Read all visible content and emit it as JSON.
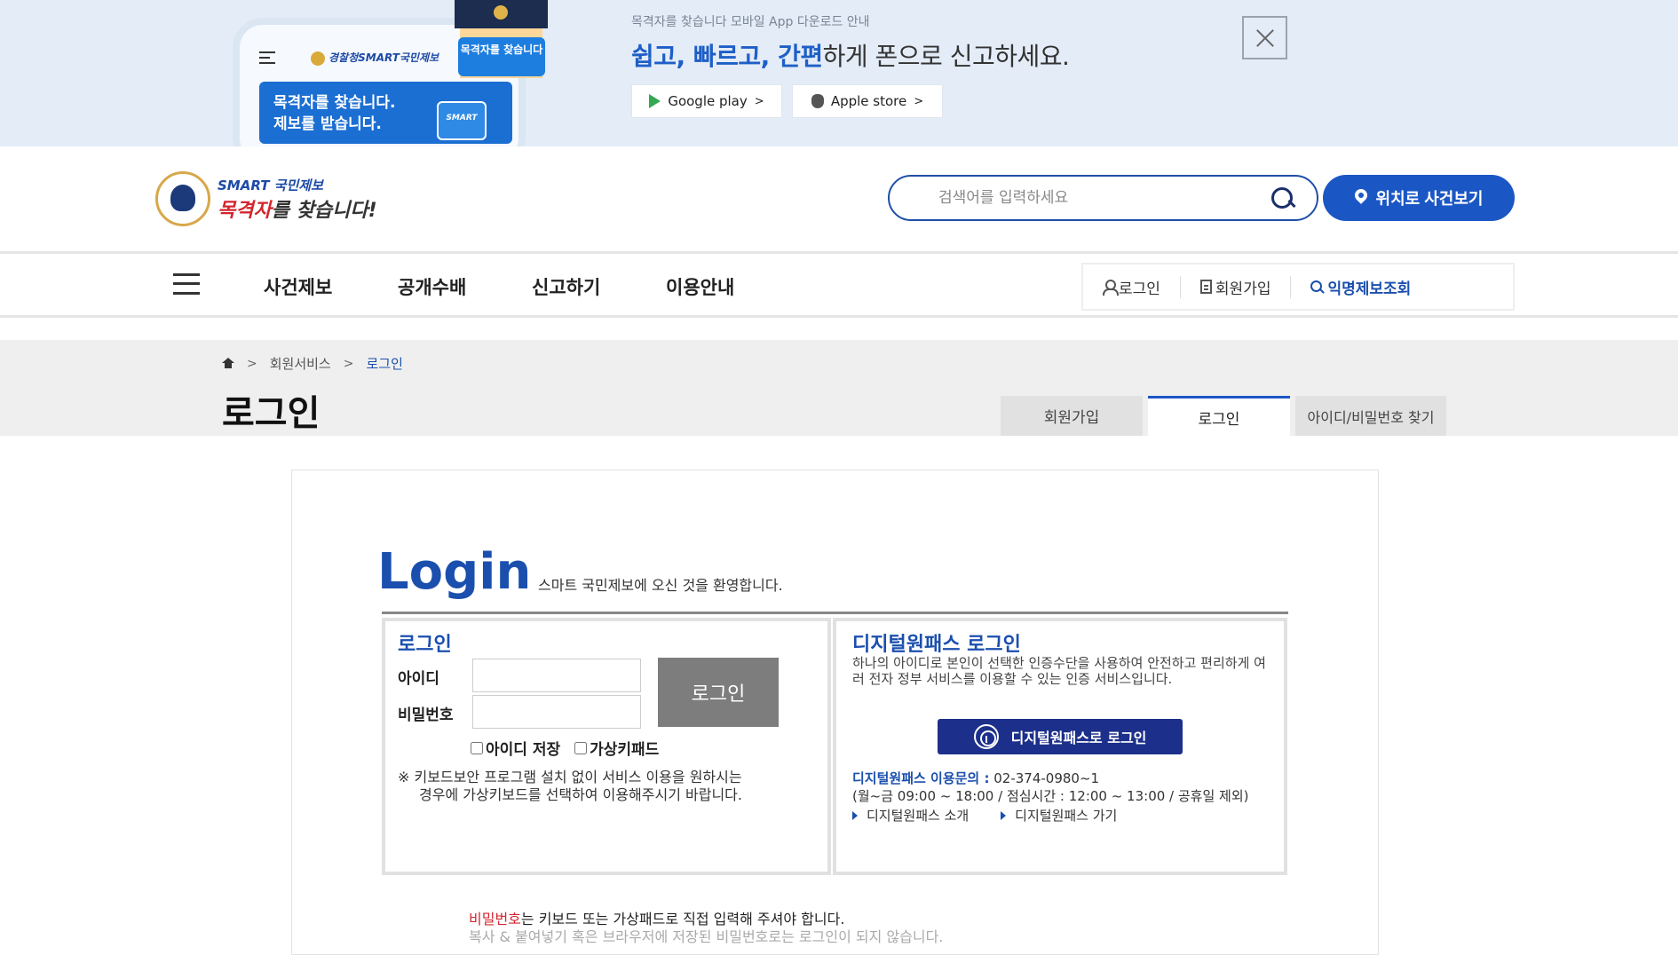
{
  "banner": {
    "subtitle": "목격자를 찾습니다 모바일 App 다운로드 안내",
    "headline_highlight": "쉽고, 빠르고, 간편",
    "headline_rest": "하게 폰으로 신고하세요.",
    "google_label": "Google play",
    "apple_label": "Apple store",
    "chevron": ">",
    "phone_logo": "경찰청SMART국민제보",
    "phone_card_line1": "목격자를 찾습니다.",
    "phone_card_line2": "제보를 받습니다.",
    "phone_mini": "SMART",
    "mascot_sign": "목격자를 찾습니다"
  },
  "header": {
    "logo_top": "SMART 국민제보",
    "logo_bottom_red": "목격자",
    "logo_bottom_rest": "를 찾습니다!",
    "search_placeholder": "검색어를 입력하세요",
    "location_button": "위치로 사건보기"
  },
  "nav": {
    "items": [
      "사건제보",
      "공개수배",
      "신고하기",
      "이용안내"
    ],
    "util": {
      "login": "로그인",
      "signup": "회원가입",
      "anonymous": "익명제보조회"
    }
  },
  "page": {
    "breadcrumb": [
      "회원서비스",
      "로그인"
    ],
    "crumb_sep": ">",
    "title": "로그인",
    "tabs": [
      "회원가입",
      "로그인",
      "아이디/비밀번호 찾기"
    ]
  },
  "login": {
    "heading": "Login",
    "welcome": "스마트 국민제보에 오신 것을 환영합니다.",
    "panel_title": "로그인",
    "id_label": "아이디",
    "pw_label": "비밀번호",
    "button": "로그인",
    "save_id": "아이디 저장",
    "virtual_keypad": "가상키패드",
    "note_line1": "※ 키보드보안 프로그램 설치 없이 서비스 이용을 원하시는",
    "note_line2": "경우에 가상키보드를 선택하여 이용해주시기 바랍니다."
  },
  "digital_onepass": {
    "title": "디지털원패스 로그인",
    "description": "하나의 아이디로 본인이 선택한 인증수단을 사용하여 안전하고 편리하게 여러 전자 정부 서비스를 이용할 수 있는 인증 서비스입니다.",
    "button": "디지털원패스로 로그인",
    "inquiry_label": "디지털원패스 이용문의 :",
    "inquiry_phone": "02-374-0980~1",
    "hours": "(월~금 09:00 ~ 18:00 / 점심시간 : 12:00 ~ 13:00 / 공휴일 제외)",
    "link_intro": "디지털원패스 소개",
    "link_go": "디지털원패스 가기"
  },
  "footer_notes": {
    "line1_red": "비밀번호",
    "line1_rest": "는 키보드 또는 가상패드로 직접 입력해 주셔야 합니다.",
    "line2": "복사 & 붙여넣기 혹은 브라우저에 저장된 비밀번호로는 로그인이 되지 않습니다."
  },
  "colors": {
    "primary": "#1b57c4",
    "brand_blue": "#1b4fae",
    "accent_red": "#d3262f",
    "banner_bg": "#e3ecf7"
  }
}
